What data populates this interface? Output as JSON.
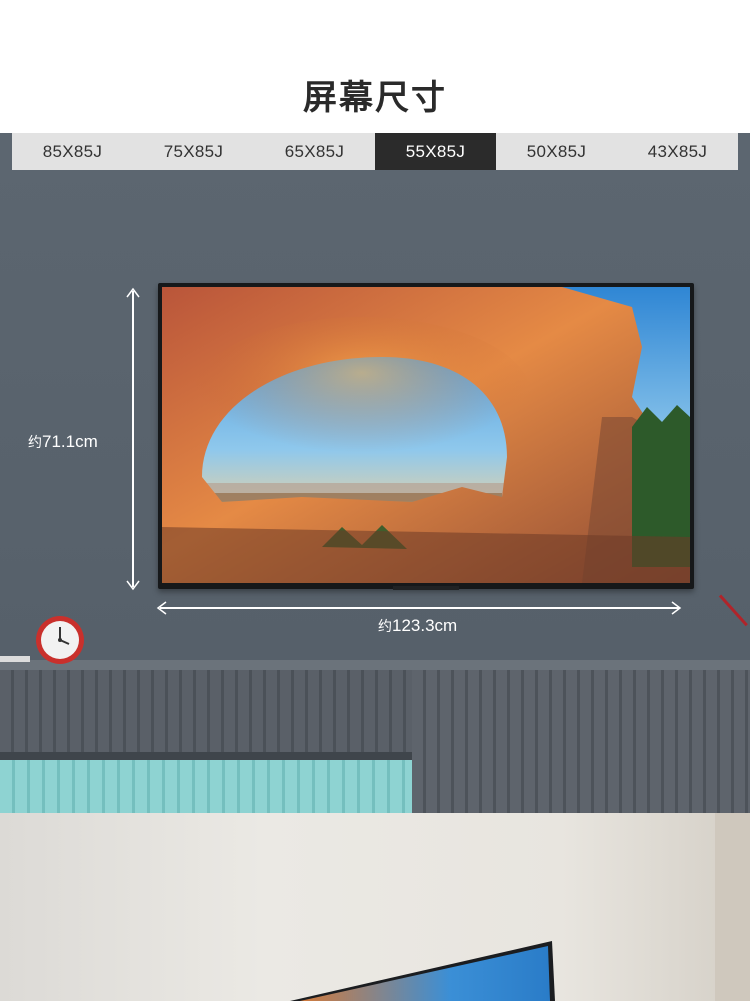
{
  "page": {
    "title": "屏幕尺寸"
  },
  "size_tabs": {
    "items": [
      {
        "label": "85X85J",
        "active": false
      },
      {
        "label": "75X85J",
        "active": false
      },
      {
        "label": "65X85J",
        "active": false
      },
      {
        "label": "55X85J",
        "active": true
      },
      {
        "label": "50X85J",
        "active": false
      },
      {
        "label": "43X85J",
        "active": false
      }
    ]
  },
  "dimensions": {
    "height": {
      "prefix": "约",
      "value": "71.1cm"
    },
    "width": {
      "prefix": "约",
      "value": "123.3cm"
    }
  },
  "colors": {
    "active_tab_bg": "#2b2b2b",
    "inactive_tab_bg": "#e2e2e2",
    "wall": "#5c6670",
    "cabinet_accent": "#8ed3d2"
  }
}
